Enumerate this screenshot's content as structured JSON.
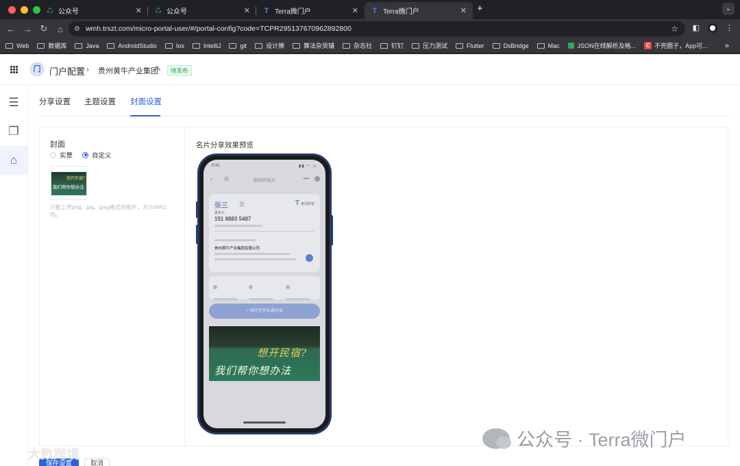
{
  "browser": {
    "tabs": [
      {
        "title": "公众号",
        "icon": "green-spinner-icon",
        "active": false
      },
      {
        "title": "公众号",
        "icon": "green-spinner-icon",
        "active": false
      },
      {
        "title": "Terra微门户",
        "icon": "terra-logo-icon",
        "active": false
      },
      {
        "title": "Terra微门户",
        "icon": "terra-logo-icon",
        "active": true
      }
    ],
    "new_tab": "+",
    "url": "wmh.trszt.com/micro-portal-user/#/portal-config?code=TCPR295137670962892800",
    "bookmarks": [
      "Web",
      "数据库",
      "Java",
      "AndroidStudio",
      "Ios",
      "IntelliJ",
      "git",
      "设计狮",
      "算法杂货铺",
      "杂志社",
      "钉钉",
      "压力测试",
      "Flutter",
      "DsBridge",
      "Mac",
      "JSON在线解析及格...",
      "不兜圈子，App可..."
    ],
    "bookmarks_more": "»"
  },
  "header": {
    "title": "门户配置",
    "org": "贵州黄牛产业集团",
    "status_badge": "待发布",
    "logo_text": "门"
  },
  "page_tabs": [
    {
      "label": "分享设置",
      "active": false
    },
    {
      "label": "主题设置",
      "active": false
    },
    {
      "label": "封面设置",
      "active": true
    }
  ],
  "cover": {
    "label": "封面",
    "options": [
      {
        "label": "实景",
        "checked": false
      },
      {
        "label": "自定义",
        "checked": true
      }
    ],
    "hint": "只能上传png、jpg、jpeg格式的图片，大小5M以内。",
    "thumb_line1": "想开民宿?",
    "thumb_line2": "我们帮你想办法"
  },
  "preview": {
    "title": "名片分享效果预览",
    "status_time": "9:41",
    "status_right": "▮▮ ◠ ▭",
    "nav_title": "他向的名片",
    "card_name": "张三",
    "card_name_sub": "男",
    "card_logo": "T",
    "card_logo_text": "泰润数智",
    "card_role": "董事长",
    "card_phone": "151 8883 5487",
    "card_company": "贵州黄牛产业集团有限公司",
    "save_button": "+ 保存至手机通讯录",
    "cover_line1": "想开民宿?",
    "cover_line2": "我们帮你想办法"
  },
  "actions": {
    "save": "保存设置",
    "cancel": "取消"
  },
  "watermarks": {
    "left": "大数跨境",
    "right": "公众号 · Terra微门户"
  }
}
